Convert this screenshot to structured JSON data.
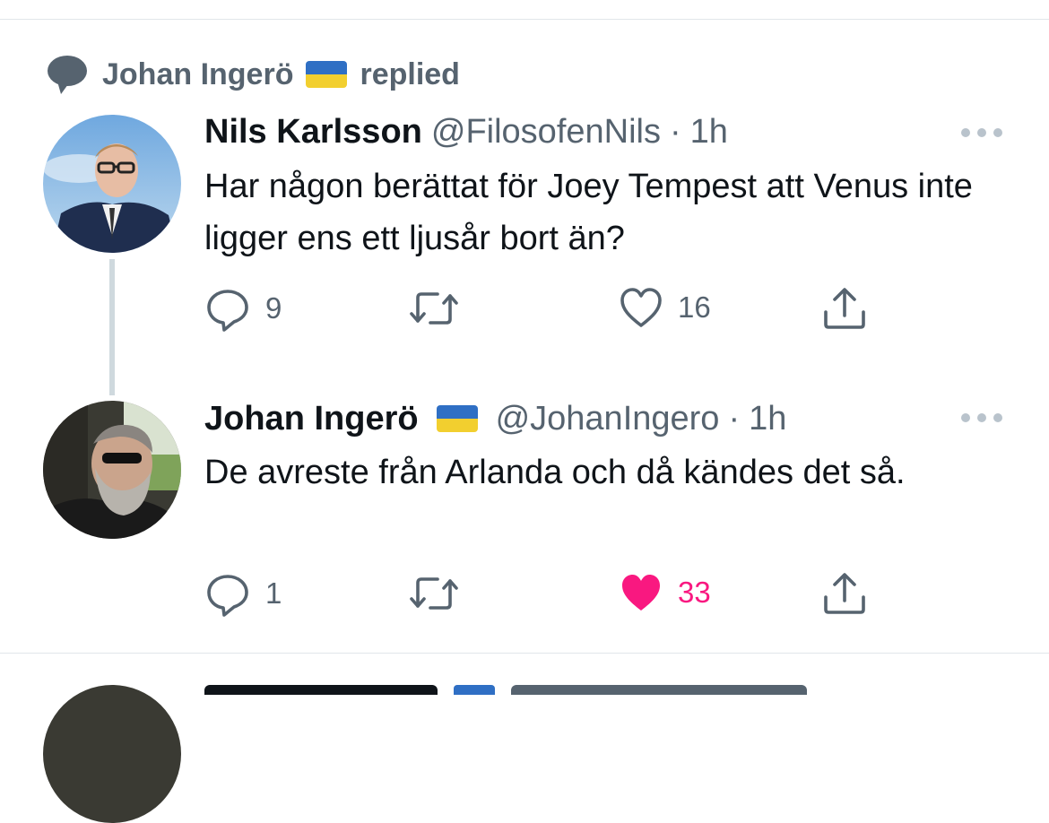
{
  "context": {
    "user": "Johan Ingerö",
    "action": "replied",
    "icon": "speech-bubble-icon"
  },
  "tweets": [
    {
      "name": "Nils Karlsson",
      "handle": "@FilosofenNils",
      "separator": "·",
      "time": "1h",
      "text": "Har någon berättat för Joey Tempest att Venus inte ligger ens ett ljusår bort än?",
      "replies": "9",
      "retweets": "",
      "likes": "16",
      "liked": false
    },
    {
      "name": "Johan Ingerö",
      "handle": "@JohanIngero",
      "separator": "·",
      "time": "1h",
      "text": "De avreste från Arlanda och då kändes det så.",
      "replies": "1",
      "retweets": "",
      "likes": "33",
      "liked": true
    }
  ],
  "colors": {
    "secondary_text": "#56636f",
    "like_active": "#f91880",
    "flag_blue": "#2f6fc4",
    "flag_yellow": "#f2cf2f"
  }
}
